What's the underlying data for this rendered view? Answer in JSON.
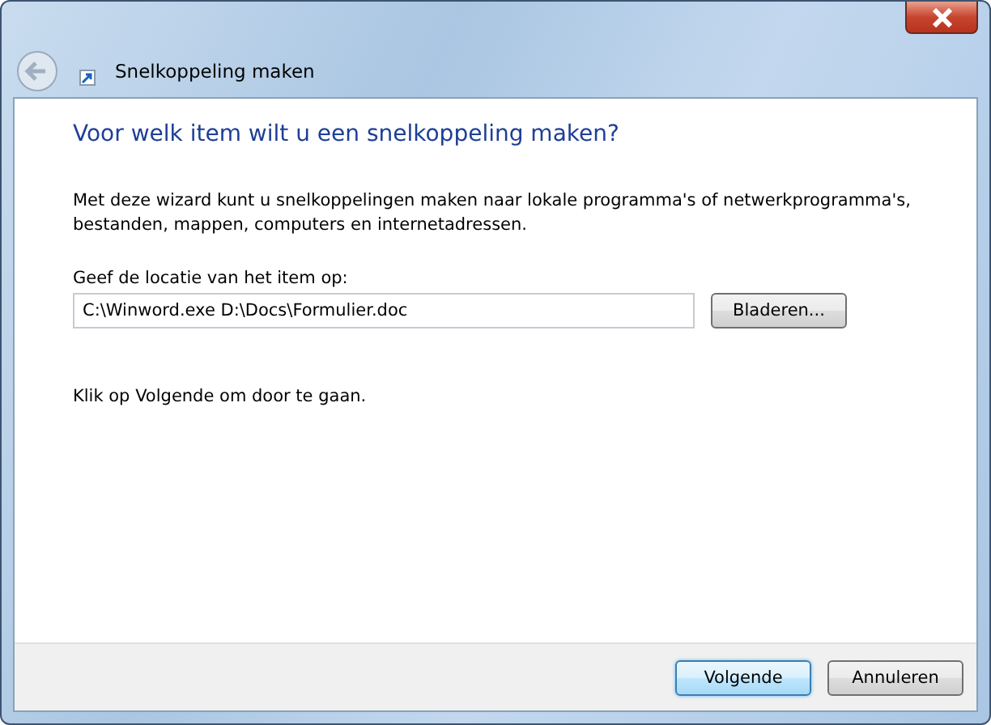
{
  "window": {
    "title": "Snelkoppeling maken"
  },
  "heading": "Voor welk item wilt u een snelkoppeling maken?",
  "description": "Met deze wizard kunt u snelkoppelingen maken naar lokale programma's of netwerkprogramma's, bestanden, mappen, computers en internetadressen.",
  "location": {
    "label": "Geef de locatie van het item op:",
    "value": "C:\\Winword.exe D:\\Docs\\Formulier.doc",
    "browse": "Bladeren..."
  },
  "hint": "Klik op Volgende om door te gaan.",
  "buttons": [
    {
      "label": "Volgende",
      "default": true
    },
    {
      "label": "Annuleren",
      "default": false
    }
  ]
}
